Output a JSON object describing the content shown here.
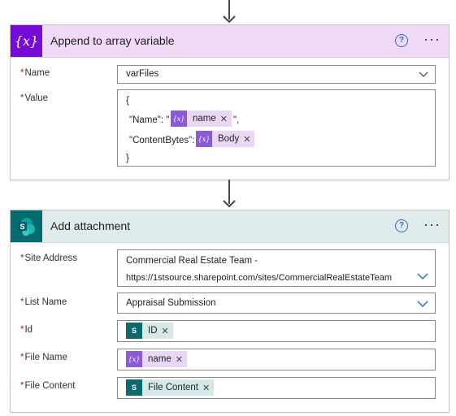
{
  "card1": {
    "title": "Append to array variable",
    "help_label": "?",
    "more_label": "···",
    "name_label": "Name",
    "name_value": "varFiles",
    "value_label": "Value",
    "value_lines": {
      "open": "{",
      "name_key": "\"Name\": \"",
      "name_suffix": "\",",
      "bytes_key": "\"ContentBytes\":",
      "close": "}"
    },
    "token_name": "name",
    "token_body": "Body",
    "required_mark": "*"
  },
  "card2": {
    "title": "Add attachment",
    "help_label": "?",
    "more_label": "···",
    "site_label": "Site Address",
    "site_value_line1": "Commercial Real Estate Team -",
    "site_value_line2": "https://1stsource.sharepoint.com/sites/CommercialRealEstateTeam",
    "list_label": "List Name",
    "list_value": "Appraisal Submission",
    "id_label": "Id",
    "id_token": "ID",
    "filename_label": "File Name",
    "filename_token": "name",
    "filecontent_label": "File Content",
    "filecontent_token": "File Content",
    "required_mark": "*"
  },
  "icons": {
    "variable_icon": "{x}",
    "token_variable_icon": "{x}",
    "sharepoint_icon": "S"
  },
  "colors": {
    "variable_accent": "#770bd6",
    "sharepoint_accent": "#036c70",
    "required": "#a4262c",
    "link": "#3a67c7"
  }
}
